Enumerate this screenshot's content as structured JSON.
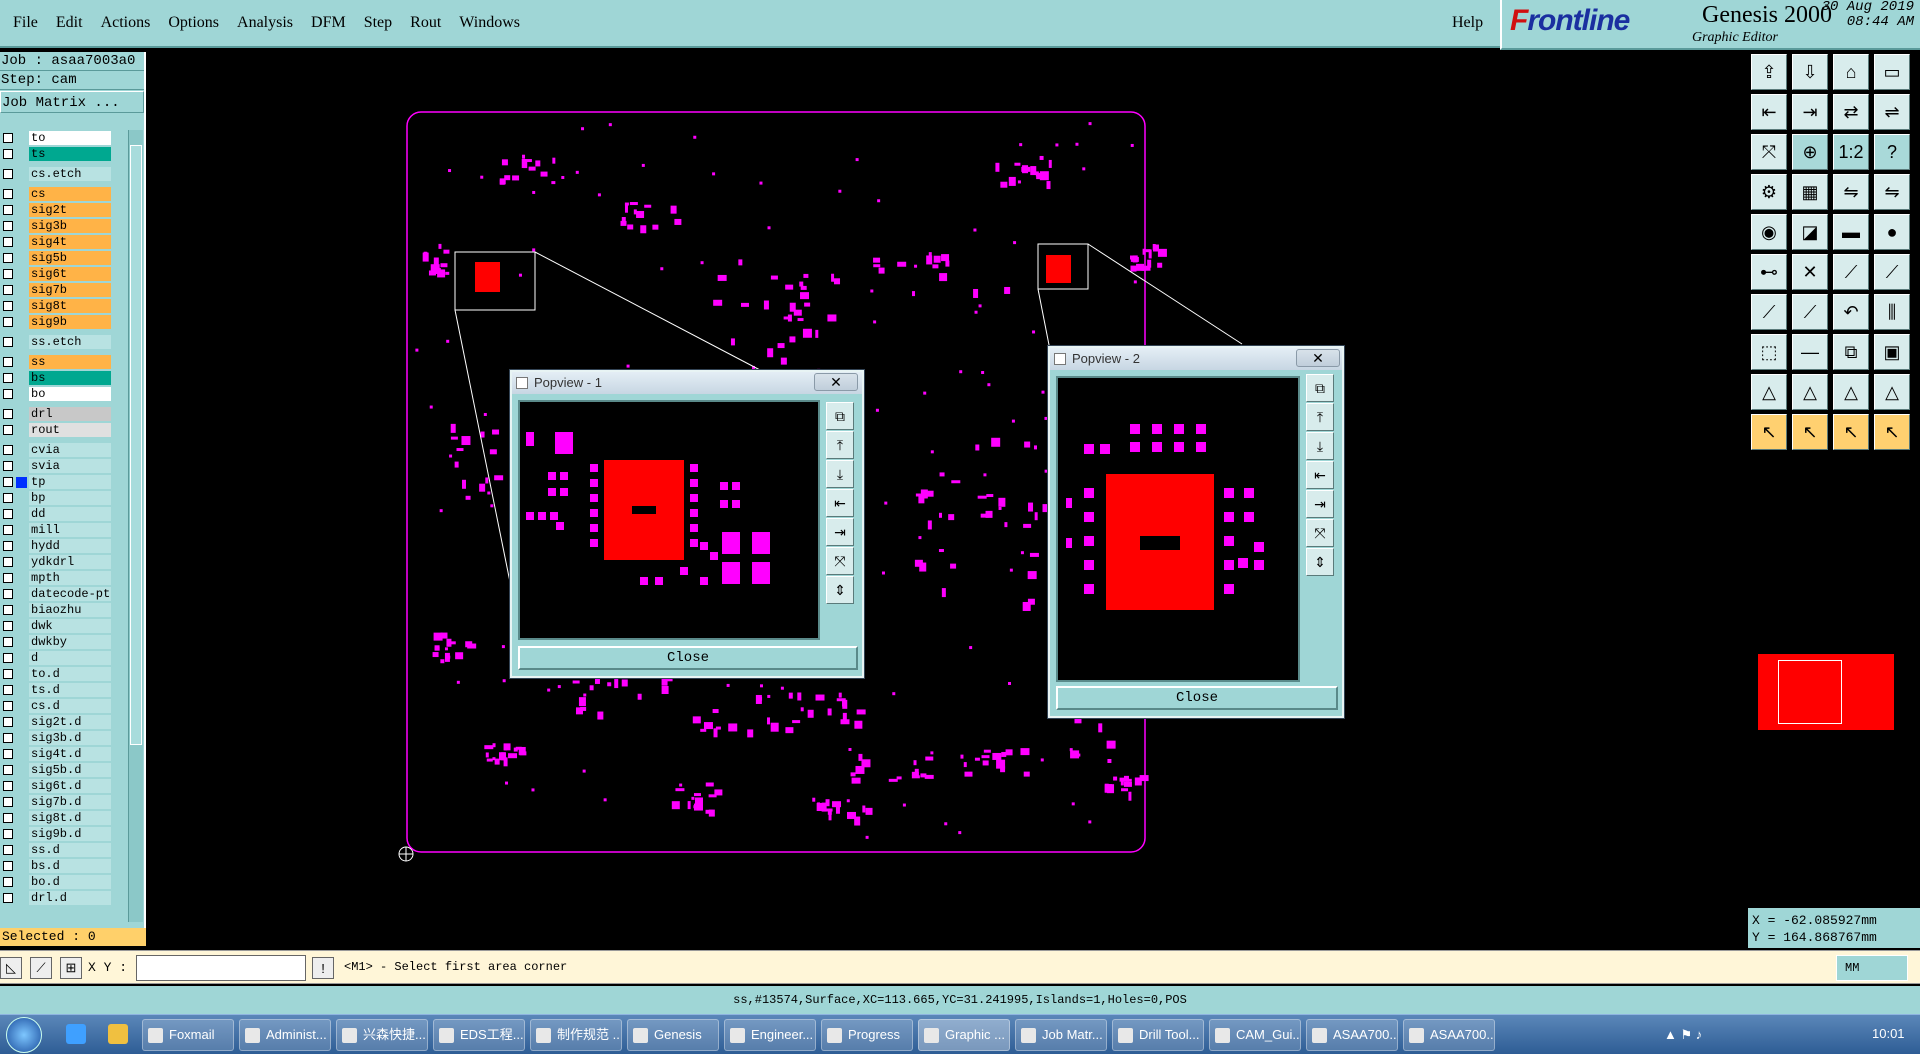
{
  "menu": [
    "File",
    "Edit",
    "Actions",
    "Options",
    "Analysis",
    "DFM",
    "Step",
    "Rout",
    "Windows"
  ],
  "help": "Help",
  "brand": {
    "logo_f": "F",
    "logo_rest": "rontline",
    "product": "Genesis 2000",
    "subtitle": "Graphic Editor",
    "date": "30 Aug 2019",
    "time": "08:44 AM"
  },
  "job": {
    "job_line": "Job : asaa7003a0",
    "step_line": "Step: cam",
    "matrix_button": "Job Matrix ..."
  },
  "layers": [
    {
      "name": "to",
      "color": "#ffffff"
    },
    {
      "name": "ts",
      "color": "#00a890"
    },
    {
      "gap": true
    },
    {
      "name": "cs.etch",
      "color": "#b8e2e2"
    },
    {
      "gap": true
    },
    {
      "name": "cs",
      "color": "#ffb347"
    },
    {
      "name": "sig2t",
      "color": "#ffb347"
    },
    {
      "name": "sig3b",
      "color": "#ffb347"
    },
    {
      "name": "sig4t",
      "color": "#ffb347"
    },
    {
      "name": "sig5b",
      "color": "#ffb347"
    },
    {
      "name": "sig6t",
      "color": "#ffb347"
    },
    {
      "name": "sig7b",
      "color": "#ffb347"
    },
    {
      "name": "sig8t",
      "color": "#ffb347"
    },
    {
      "name": "sig9b",
      "color": "#ffb347"
    },
    {
      "gap": true
    },
    {
      "name": "ss.etch",
      "color": "#b8e2e2"
    },
    {
      "gap": true
    },
    {
      "name": "ss",
      "color": "#ffb347"
    },
    {
      "name": "bs",
      "color": "#00a890"
    },
    {
      "name": "bo",
      "color": "#ffffff"
    },
    {
      "gap": true
    },
    {
      "name": "drl",
      "color": "#c8c8c8"
    },
    {
      "name": "rout",
      "color": "#e0e0e0"
    },
    {
      "gap": true
    },
    {
      "name": "cvia",
      "color": "#b8e2e2"
    },
    {
      "name": "svia",
      "color": "#b8e2e2"
    },
    {
      "name": "tp",
      "color": "#b8e2e2",
      "selected": true
    },
    {
      "name": "bp",
      "color": "#b8e2e2"
    },
    {
      "name": "dd",
      "color": "#b8e2e2"
    },
    {
      "name": "mill",
      "color": "#b8e2e2"
    },
    {
      "name": "hydd",
      "color": "#b8e2e2"
    },
    {
      "name": "ydkdrl",
      "color": "#b8e2e2"
    },
    {
      "name": "mpth",
      "color": "#b8e2e2"
    },
    {
      "name": "datecode-pt",
      "color": "#b8e2e2"
    },
    {
      "name": "biaozhu",
      "color": "#b8e2e2"
    },
    {
      "name": "dwk",
      "color": "#b8e2e2"
    },
    {
      "name": "dwkby",
      "color": "#b8e2e2"
    },
    {
      "name": "d",
      "color": "#b8e2e2"
    },
    {
      "name": "to.d",
      "color": "#b8e2e2"
    },
    {
      "name": "ts.d",
      "color": "#b8e2e2"
    },
    {
      "name": "cs.d",
      "color": "#b8e2e2"
    },
    {
      "name": "sig2t.d",
      "color": "#b8e2e2"
    },
    {
      "name": "sig3b.d",
      "color": "#b8e2e2"
    },
    {
      "name": "sig4t.d",
      "color": "#b8e2e2"
    },
    {
      "name": "sig5b.d",
      "color": "#b8e2e2"
    },
    {
      "name": "sig6t.d",
      "color": "#b8e2e2"
    },
    {
      "name": "sig7b.d",
      "color": "#b8e2e2"
    },
    {
      "name": "sig8t.d",
      "color": "#b8e2e2"
    },
    {
      "name": "sig9b.d",
      "color": "#b8e2e2"
    },
    {
      "name": "ss.d",
      "color": "#b8e2e2"
    },
    {
      "name": "bs.d",
      "color": "#b8e2e2"
    },
    {
      "name": "bo.d",
      "color": "#b8e2e2"
    },
    {
      "name": "drl.d",
      "color": "#b8e2e2"
    }
  ],
  "selected_text": "Selected : 0",
  "popup1": {
    "title": "Popview - 1",
    "close": "Close",
    "x": "✕"
  },
  "popup2": {
    "title": "Popview - 2",
    "close": "Close",
    "x": "✕"
  },
  "coords": {
    "x": "X = -62.085927mm",
    "y": "Y = 164.868767mm"
  },
  "bottom": {
    "xy_label": "X Y :",
    "prompt": "<M1> - Select first area corner",
    "units": "MM"
  },
  "status_line": "ss,#13574,Surface,XC=113.665,YC=31.241995,Islands=1,Holes=0,POS",
  "taskbar": [
    "Foxmail",
    "Administ...",
    "兴森快捷...",
    "EDS工程...",
    "制作规范 ...",
    "Genesis",
    "Engineer...",
    "Progress",
    "Graphic ...",
    "Job Matr...",
    "Drill Tool...",
    "CAM_Gui...",
    "ASAA700...",
    "ASAA700..."
  ],
  "clock": "10:01",
  "colors": {
    "panel": "#9fd6d6",
    "pad": "#ff00ff",
    "surface": "#ff0000"
  }
}
